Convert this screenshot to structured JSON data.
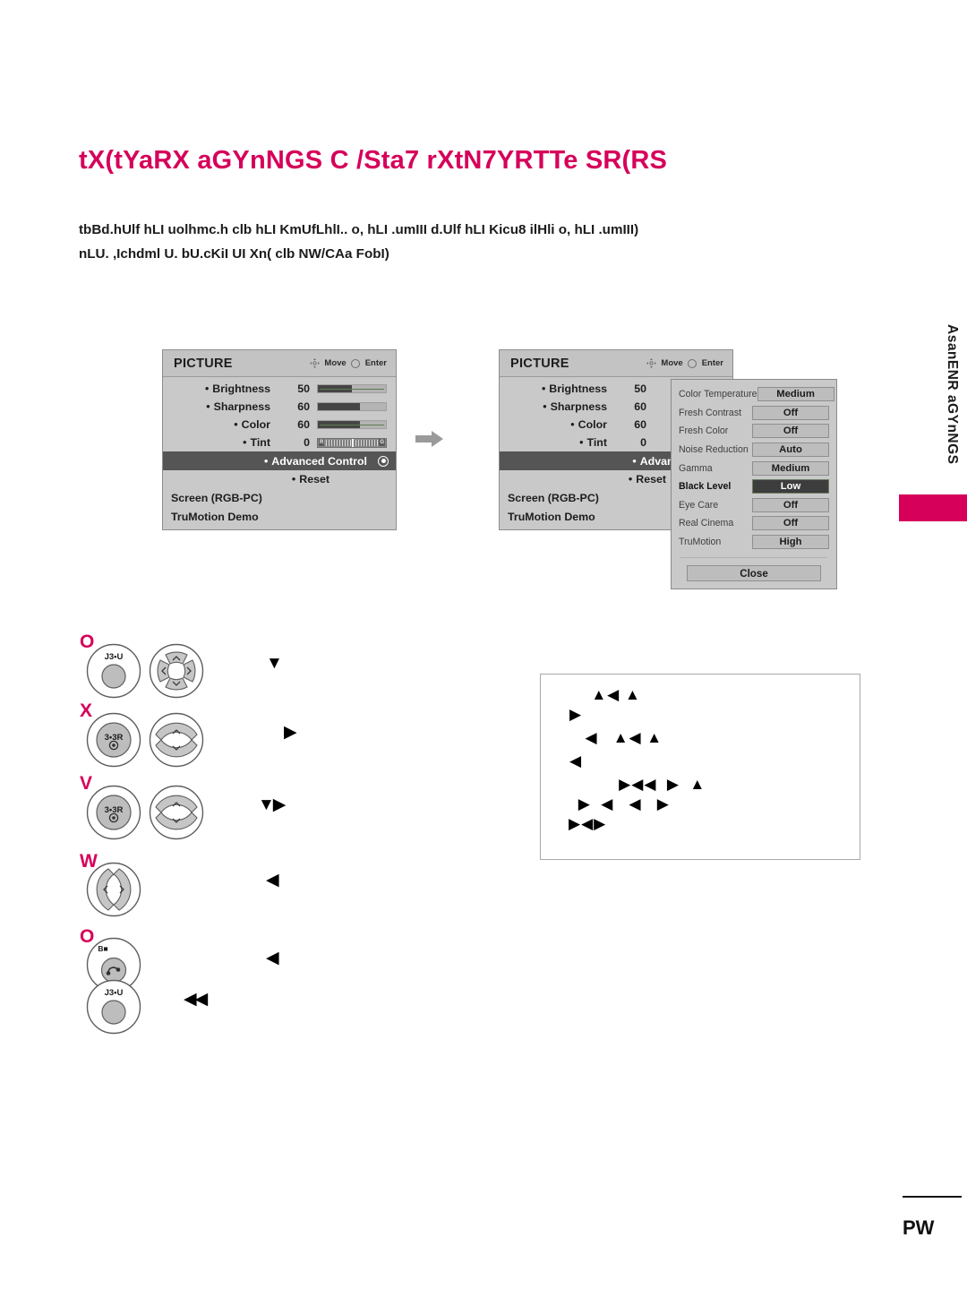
{
  "page": {
    "title": "tX(tYaRX aGYnNGS C /Sta7 rXtN7YRTTe SR(RS",
    "paragraph_line1": "tbBd.hUlf hLI uolhmc.h clb hLI KmUfLhlI.. o, hLI .umIII d.Ulf hLI Kicu8 ilHli o, hLI .umIII)",
    "paragraph_line2": "nLU. ,Ichdml U. bU.cKiI UI Xn( clb NW/CAa FobI)",
    "side_tab_text": "AsanENR aGYnNGS",
    "page_number": "PW",
    "accent_color": "#d6005a"
  },
  "menu_left": {
    "title": "PICTURE",
    "hint_move": "Move",
    "hint_enter": "Enter",
    "rows": [
      {
        "label": "Brightness",
        "value": "50",
        "fill_pct": 50,
        "type": "slider"
      },
      {
        "label": "Sharpness",
        "value": "60",
        "fill_pct": 62,
        "type": "slider"
      },
      {
        "label": "Color",
        "value": "60",
        "fill_pct": 62,
        "type": "slider"
      },
      {
        "label": "Tint",
        "value": "0",
        "type": "tint",
        "left_cap": "R",
        "right_cap": "G"
      }
    ],
    "selected_row": "Advanced Control",
    "reset_row": "Reset",
    "footer_rows": [
      "Screen (RGB-PC)",
      "TruMotion Demo"
    ]
  },
  "menu_right": {
    "title": "PICTURE",
    "hint_move": "Move",
    "hint_enter": "Enter",
    "rows": [
      {
        "label": "Brightness",
        "value": "50"
      },
      {
        "label": "Sharpness",
        "value": "60"
      },
      {
        "label": "Color",
        "value": "60"
      },
      {
        "label": "Tint",
        "value": "0"
      }
    ],
    "selected_row": "Advanced Contro",
    "reset_row": "Reset",
    "footer_rows": [
      "Screen (RGB-PC)",
      "TruMotion Demo"
    ]
  },
  "advanced_control": {
    "items": [
      {
        "label": "Color Temperature",
        "value": "Medium",
        "selected": false
      },
      {
        "label": "Fresh Contrast",
        "value": "Off",
        "selected": false
      },
      {
        "label": "Fresh Color",
        "value": "Off",
        "selected": false
      },
      {
        "label": "Noise Reduction",
        "value": "Auto",
        "selected": false
      },
      {
        "label": "Gamma",
        "value": "Medium",
        "selected": false
      },
      {
        "label": "Black Level",
        "value": "Low",
        "selected": true
      },
      {
        "label": "Eye Care",
        "value": "Off",
        "selected": false
      },
      {
        "label": "Real Cinema",
        "value": "Off",
        "selected": false
      },
      {
        "label": "TruMotion",
        "value": "High",
        "selected": false
      }
    ],
    "close_label": "Close"
  },
  "steps": [
    {
      "letter": "O",
      "key_label": "J3•U",
      "pad": "dpad",
      "note": "▼"
    },
    {
      "letter": "X",
      "key_label": "3•3R",
      "pad": "updown",
      "note": "▶"
    },
    {
      "letter": "V",
      "key_label": "3•3R",
      "pad": "updown",
      "note": "▼▶"
    },
    {
      "letter": "W",
      "key_label": "",
      "pad": "leftright",
      "note": "◀"
    },
    {
      "letter": "O",
      "key_label": "B■",
      "pad": "none",
      "note": "◀"
    },
    {
      "letter": "",
      "key_label": "J3•U",
      "pad": "none",
      "note": "◀◀"
    }
  ],
  "glyph_panel": {
    "lines": [
      "      ▲◀ ▲",
      "▶",
      "  ◀   ▲◀ ▲",
      "◀",
      "   ▶◀◀  ▶  ▲",
      " ▶  ◀   ◀   ▶",
      "▶◀▶"
    ]
  }
}
